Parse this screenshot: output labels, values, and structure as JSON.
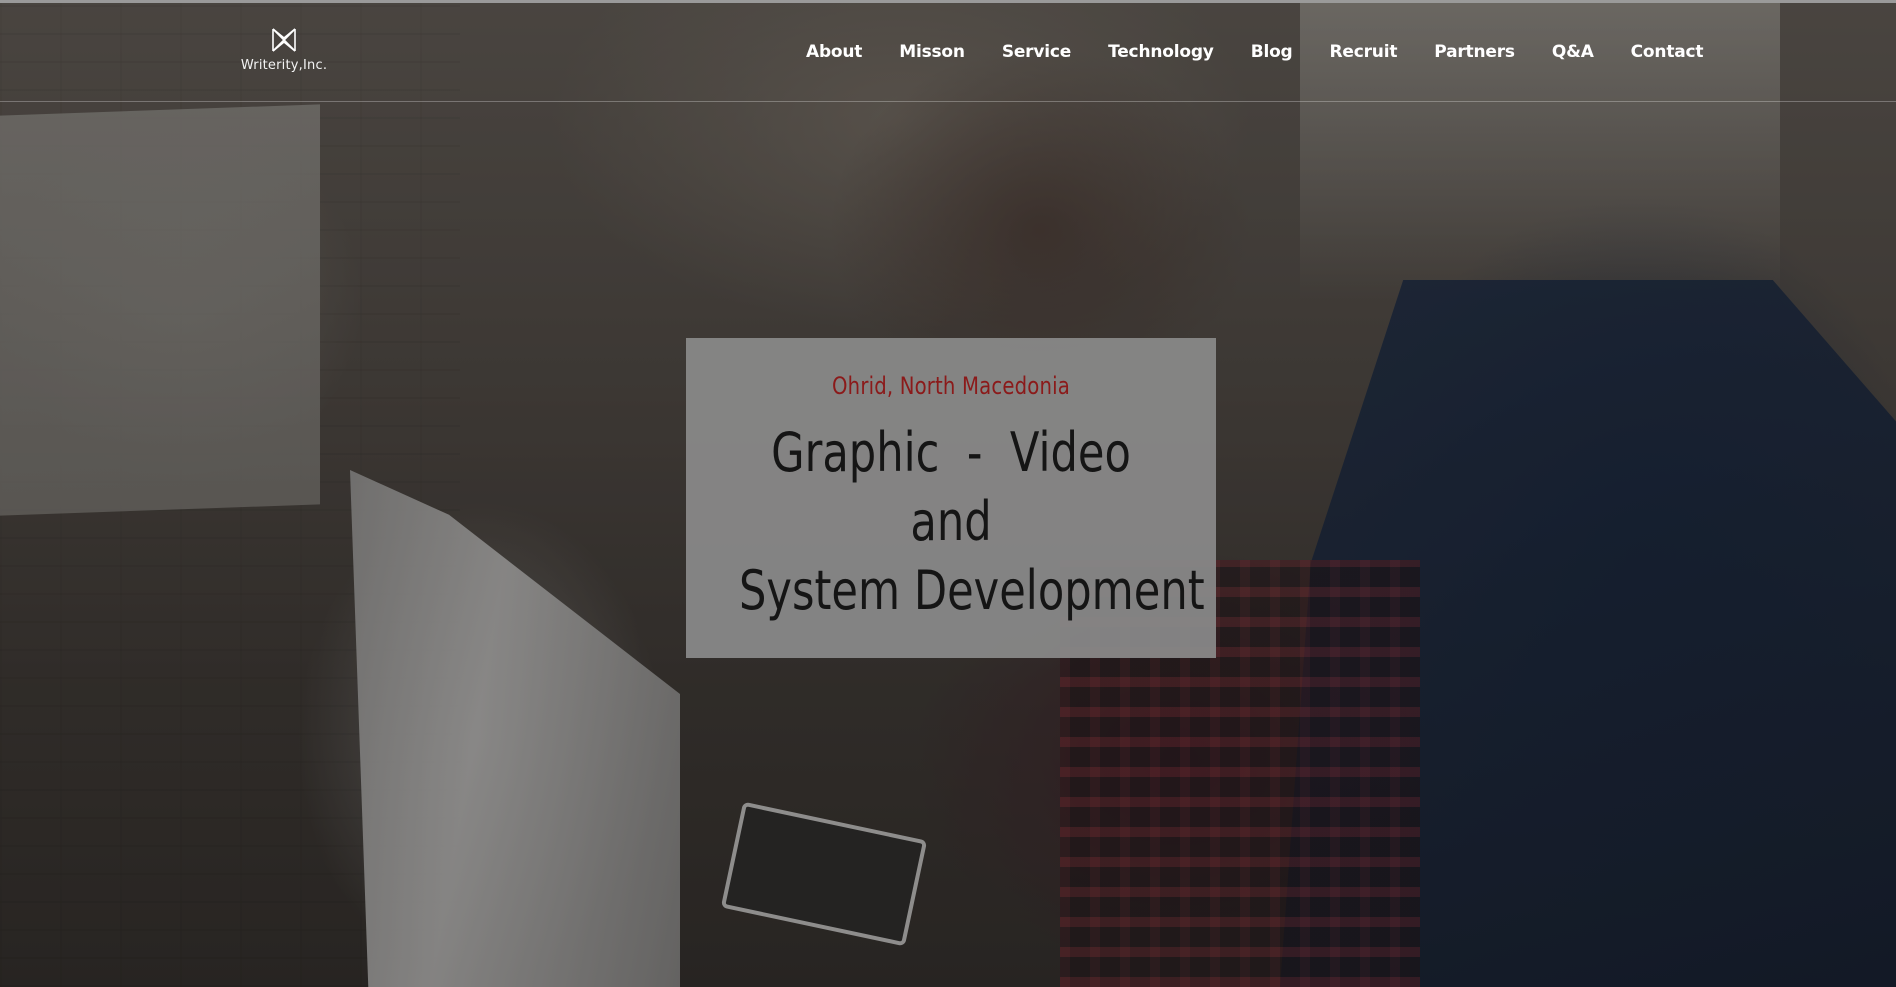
{
  "logo": {
    "icon": "writerity-logo-mark",
    "text": "Writerity,Inc."
  },
  "nav": {
    "items": [
      {
        "label": "About"
      },
      {
        "label": "Misson"
      },
      {
        "label": "Service"
      },
      {
        "label": "Technology"
      },
      {
        "label": "Blog"
      },
      {
        "label": "Recruit"
      },
      {
        "label": "Partners"
      },
      {
        "label": "Q&A"
      },
      {
        "label": "Contact"
      }
    ]
  },
  "hero": {
    "location": "Ohrid, North Macedonia",
    "title_lines": [
      "Graphic  -  Video",
      "and",
      "System Development"
    ]
  },
  "colors": {
    "location_text": "#8b1a1a",
    "card_background": "#8a8a8a",
    "nav_text": "#ffffff"
  }
}
